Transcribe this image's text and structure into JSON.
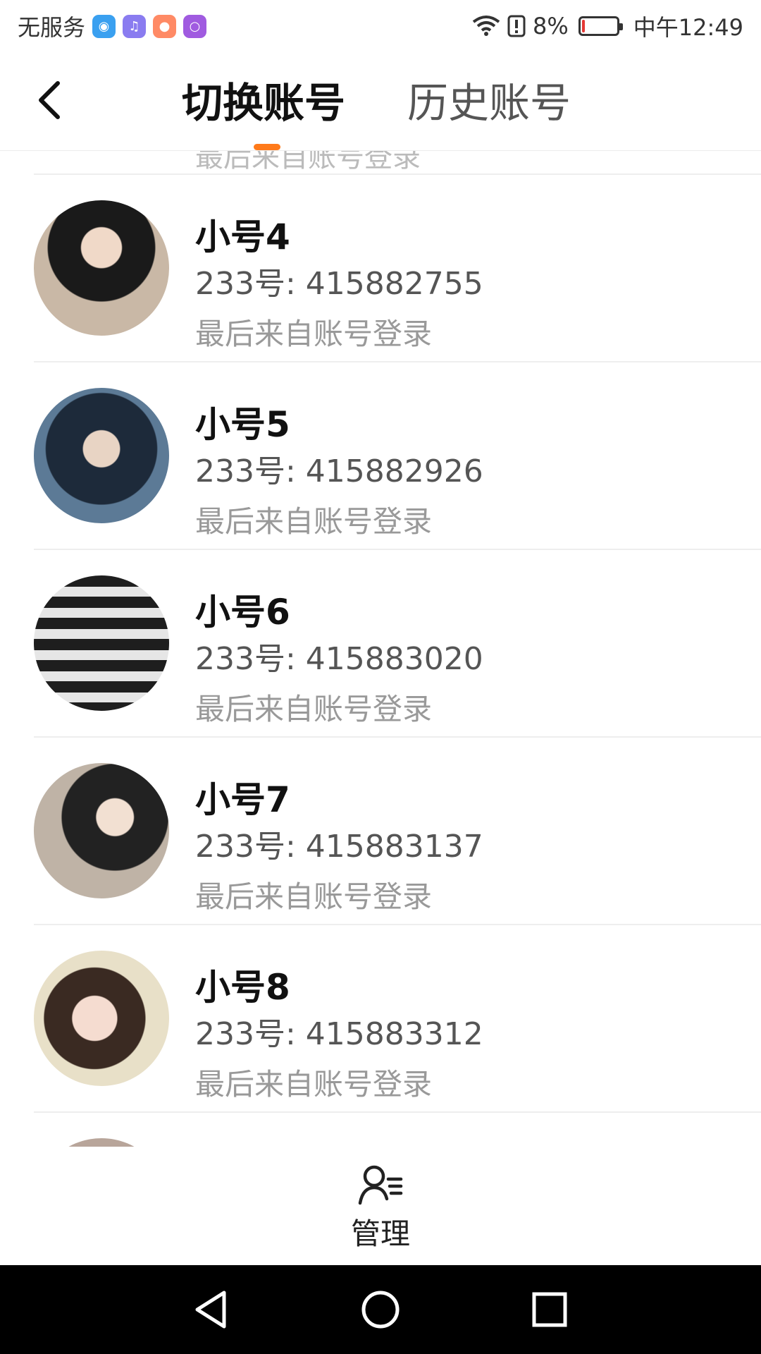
{
  "status_bar": {
    "carrier": "无服务",
    "battery_percent": "8%",
    "battery_level": 0.08,
    "time": "中午12:49",
    "icons": [
      "shield-app-icon",
      "music-app-icon",
      "game-app-icon",
      "chat-app-icon",
      "wifi-icon",
      "alert-icon",
      "battery-icon"
    ]
  },
  "header": {
    "tabs": [
      {
        "label": "切换账号",
        "active": true
      },
      {
        "label": "历史账号",
        "active": false
      }
    ],
    "accent_color": "#ff7a1a"
  },
  "accounts": [
    {
      "name": "小号4",
      "id_line": "233号: 415882755",
      "last_login": "最后来自账号登录"
    },
    {
      "name": "小号5",
      "id_line": "233号: 415882926",
      "last_login": "最后来自账号登录"
    },
    {
      "name": "小号6",
      "id_line": "233号: 415883020",
      "last_login": "最后来自账号登录"
    },
    {
      "name": "小号7",
      "id_line": "233号: 415883137",
      "last_login": "最后来自账号登录"
    },
    {
      "name": "小号8",
      "id_line": "233号: 415883312",
      "last_login": "最后来自账号登录"
    }
  ],
  "partial_top_text": "最后来自账号登录",
  "bottom": {
    "manage_label": "管理"
  }
}
